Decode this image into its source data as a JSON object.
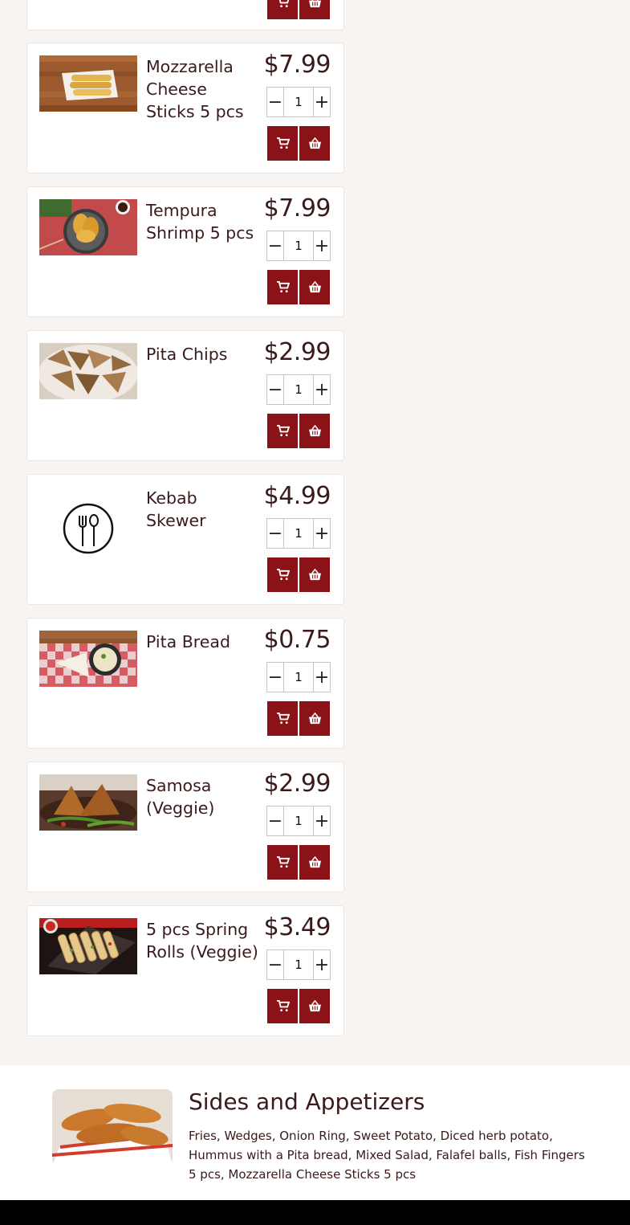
{
  "colors": {
    "accent": "#8b1217",
    "page_bg": "#f8f4f1",
    "text": "#3a1a1a"
  },
  "items": [
    {
      "name": "Mozzarella Cheese Sticks 5 pcs",
      "price": "$7.99",
      "qty": "1",
      "image": "mozzarella-sticks-photo"
    },
    {
      "name": "Tempura Shrimp 5 pcs",
      "price": "$7.99",
      "qty": "1",
      "image": "tempura-shrimp-photo"
    },
    {
      "name": "Pita Chips",
      "price": "$2.99",
      "qty": "1",
      "image": "pita-chips-photo"
    },
    {
      "name": "Kebab Skewer",
      "price": "$4.99",
      "qty": "1",
      "image": "fork-spoon-placeholder-icon"
    },
    {
      "name": "Pita Bread",
      "price": "$0.75",
      "qty": "1",
      "image": "pita-bread-photo"
    },
    {
      "name": "Samosa (Veggie)",
      "price": "$2.99",
      "qty": "1",
      "image": "samosa-photo"
    },
    {
      "name": "5 pcs Spring Rolls (Veggie)",
      "price": "$3.49",
      "qty": "1",
      "image": "spring-rolls-photo"
    }
  ],
  "controls": {
    "minus_symbol": "−",
    "plus_symbol": "+",
    "cart_icon": "cart-icon",
    "basket_icon": "basket-icon"
  },
  "category": {
    "title": "Sides and Appetizers",
    "description": "Fries, Wedges, Onion Ring, Sweet Potato, Diced herb potato, Hummus with a Pita bread, Mixed Salad, Falafel balls, Fish Fingers 5 pcs, Mozzarella Cheese Sticks 5 pcs",
    "image": "fried-tenders-photo"
  }
}
